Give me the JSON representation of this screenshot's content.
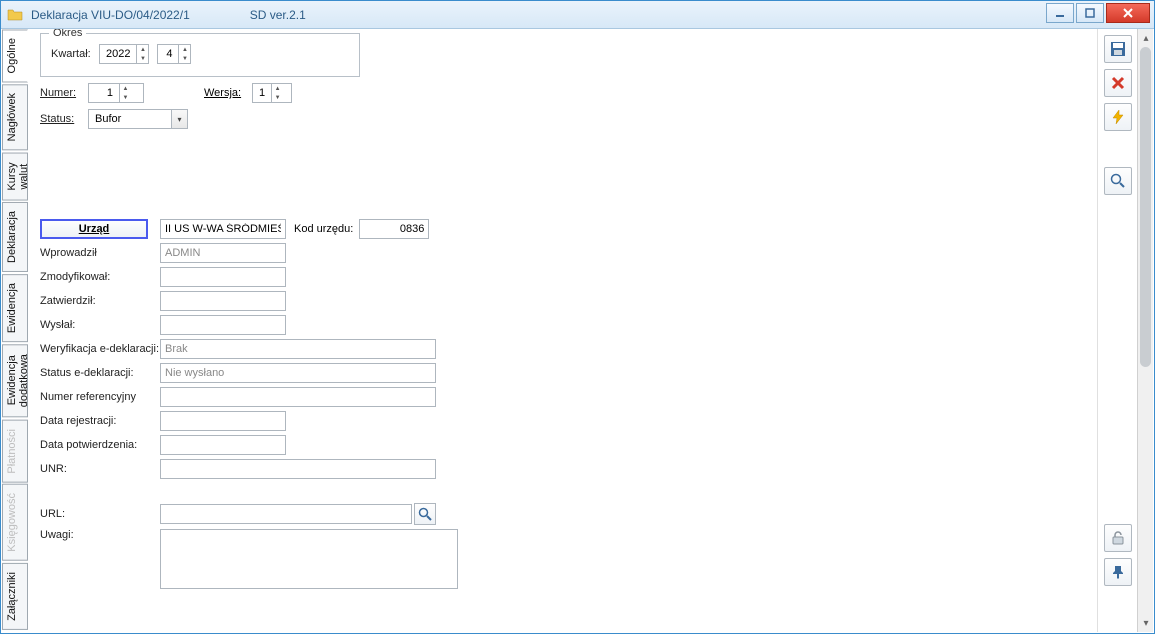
{
  "window": {
    "title": "Deklaracja VIU-DO/04/2022/1",
    "subtitle": "SD ver.2.1"
  },
  "tabs": {
    "items": [
      {
        "label": "Ogólne",
        "disabled": false,
        "active": true
      },
      {
        "label": "Nagłówek",
        "disabled": false
      },
      {
        "label": "Kursy walut",
        "disabled": false
      },
      {
        "label": "Deklaracja",
        "disabled": false
      },
      {
        "label": "Ewidencja",
        "disabled": false
      },
      {
        "label": "Ewidencja dodatkowa",
        "disabled": false
      },
      {
        "label": "Płatności",
        "disabled": true
      },
      {
        "label": "Księgowość",
        "disabled": true
      },
      {
        "label": "Załączniki",
        "disabled": false
      }
    ]
  },
  "okres": {
    "legend": "Okres",
    "kwartal_label": "Kwartał:",
    "year": "2022",
    "quarter": "4"
  },
  "form": {
    "numer_label": "Numer:",
    "numer": "1",
    "wersja_label": "Wersja:",
    "wersja": "1",
    "status_label": "Status:",
    "status_value": "Bufor"
  },
  "urzad": {
    "button": "Urząd",
    "name": "II US W-WA ŚRÓDMIEŚC",
    "kod_label": "Kod urzędu:",
    "kod": "0836"
  },
  "audit": {
    "wprowadzil_label": "Wprowadził",
    "wprowadzil": "ADMIN",
    "zmodyfikowal_label": "Zmodyfikował:",
    "zmodyfikowal": "",
    "zatwierdzil_label": "Zatwierdził:",
    "zatwierdzil": "",
    "wyslal_label": "Wysłał:",
    "wyslal": ""
  },
  "edekl": {
    "weryfikacja_label": "Weryfikacja e-deklaracji:",
    "weryfikacja": "Brak",
    "status_label": "Status e-deklaracji:",
    "status": "Nie wysłano",
    "numer_ref_label": "Numer referencyjny",
    "numer_ref": "",
    "data_rej_label": "Data rejestracji:",
    "data_rej": "",
    "data_pot_label": "Data potwierdzenia:",
    "data_pot": "",
    "unr_label": "UNR:",
    "unr": ""
  },
  "bottom": {
    "url_label": "URL:",
    "url": "",
    "uwagi_label": "Uwagi:",
    "uwagi": ""
  }
}
